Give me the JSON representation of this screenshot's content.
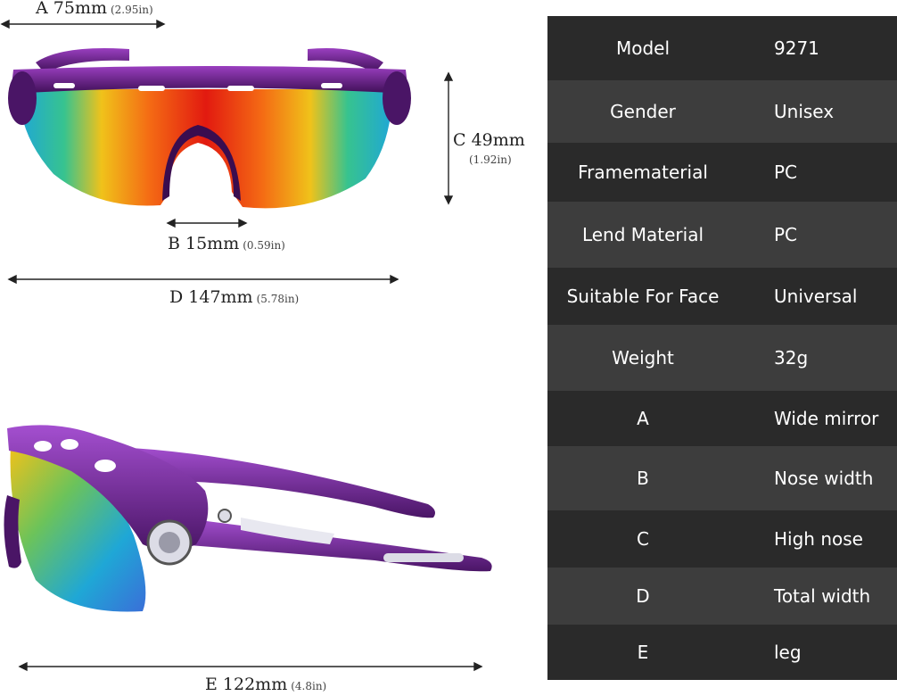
{
  "dimensions": {
    "a": {
      "label": "A 75mm",
      "inches": "(2.95in)"
    },
    "b": {
      "label": "B 15mm",
      "inches": "(0.59in)"
    },
    "c": {
      "label": "C 49mm",
      "inches": "(1.92in)"
    },
    "d": {
      "label": "D 147mm",
      "inches": "(5.78in)"
    },
    "e": {
      "label": "E 122mm",
      "inches": "(4.8in)"
    }
  },
  "specs": [
    {
      "key": "Model",
      "value": "9271"
    },
    {
      "key": "Gender",
      "value": "Unisex"
    },
    {
      "key": "Framematerial",
      "value": "PC"
    },
    {
      "key": "Lend Material",
      "value": "PC"
    },
    {
      "key": "Suitable For Face",
      "value": "Universal"
    },
    {
      "key": "Weight",
      "value": "32g"
    },
    {
      "key": "A",
      "value": "Wide mirror"
    },
    {
      "key": "B",
      "value": "Nose width"
    },
    {
      "key": "C",
      "value": "High nose"
    },
    {
      "key": "D",
      "value": "Total width"
    },
    {
      "key": "E",
      "value": "leg"
    }
  ],
  "colors": {
    "frame": "#6b1f8f",
    "table_dark": "#2a2a2a",
    "table_light": "#3d3d3d"
  }
}
